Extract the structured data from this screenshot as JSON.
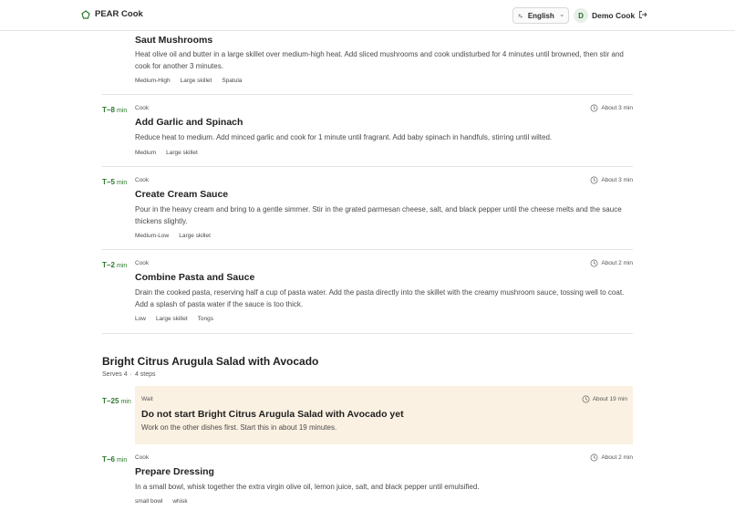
{
  "header": {
    "brand": "PEAR Cook",
    "language": "English",
    "avatar_initial": "D",
    "user_name": "Demo Cook"
  },
  "steps": [
    {
      "time": "",
      "unit": "",
      "kind": "",
      "duration": "",
      "title": "Saut  Mushrooms",
      "description": "Heat olive oil and butter in a large skillet over medium-high heat. Add sliced mushrooms and cook undisturbed for 4 minutes until browned, then stir and cook for another 3 minutes.",
      "tags": [
        "Medium-High",
        "Large skillet",
        "Spatula"
      ]
    },
    {
      "time": "T−8",
      "unit": "min",
      "kind": "Cook",
      "duration": "About 3 min",
      "title": "Add Garlic and Spinach",
      "description": "Reduce heat to medium. Add minced garlic and cook for 1 minute until fragrant. Add baby spinach in handfuls, stirring until wilted.",
      "tags": [
        "Medium",
        "Large skillet"
      ]
    },
    {
      "time": "T−5",
      "unit": "min",
      "kind": "Cook",
      "duration": "About 3 min",
      "title": "Create Cream Sauce",
      "description": "Pour in the heavy cream and bring to a gentle simmer. Stir in the grated parmesan cheese, salt, and black pepper until the cheese melts and the sauce thickens slightly.",
      "tags": [
        "Medium-Low",
        "Large skillet"
      ]
    },
    {
      "time": "T−2",
      "unit": "min",
      "kind": "Cook",
      "duration": "About 2 min",
      "title": "Combine Pasta and Sauce",
      "description": "Drain the cooked pasta, reserving half a cup of pasta water. Add the pasta directly into the skillet with the creamy mushroom sauce, tossing well to coat. Add a splash of pasta water if the sauce is too thick.",
      "tags": [
        "Low",
        "Large skillet",
        "Tongs"
      ]
    }
  ],
  "section": {
    "title": "Bright Citrus Arugula Salad with Avocado",
    "serves": "Serves 4",
    "separator": "·",
    "steps_count": "4 steps"
  },
  "wait_step": {
    "time": "T−25",
    "unit": "min",
    "kind": "Wait",
    "duration": "About 19 min",
    "title": "Do not start Bright Citrus Arugula Salad with Avocado yet",
    "description": "Work on the other dishes first. Start this in about 19 minutes."
  },
  "last_step": {
    "time": "T−6",
    "unit": "min",
    "kind": "Cook",
    "duration": "About 2 min",
    "title": "Prepare Dressing",
    "description": "In a small bowl, whisk together the extra virgin olive oil, lemon juice, salt, and black pepper until emulsified.",
    "tags": [
      "small bowl",
      "whisk"
    ]
  },
  "colors": {
    "accent": "#2d7a2d",
    "wait_background": "#fbf1e2"
  }
}
